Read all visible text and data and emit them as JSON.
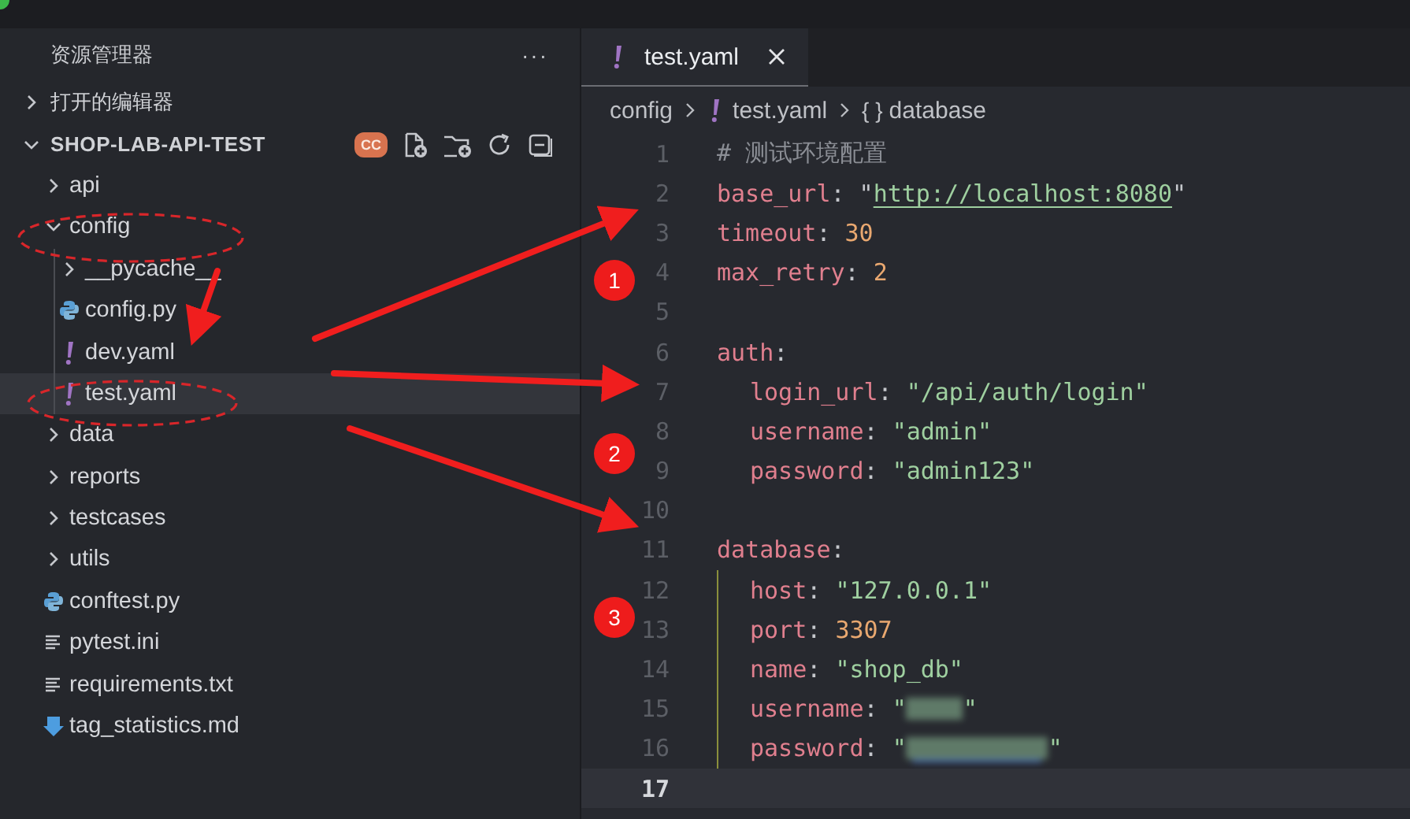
{
  "sidebar": {
    "title": "资源管理器",
    "more": "···",
    "sections": [
      {
        "label": "打开的编辑器",
        "expanded": false
      },
      {
        "label": "SHOP-LAB-API-TEST",
        "expanded": true,
        "badge": "CC"
      }
    ],
    "tree": [
      {
        "name": "api",
        "kind": "folder",
        "expanded": false,
        "selected": false
      },
      {
        "name": "config",
        "kind": "folder",
        "expanded": true,
        "selected": false,
        "children": [
          {
            "name": "__pycache__",
            "kind": "folder",
            "expanded": false,
            "selected": false
          },
          {
            "name": "config.py",
            "kind": "python",
            "selected": false
          },
          {
            "name": "dev.yaml",
            "kind": "yaml",
            "selected": false
          },
          {
            "name": "test.yaml",
            "kind": "yaml",
            "selected": true
          }
        ]
      },
      {
        "name": "data",
        "kind": "folder",
        "expanded": false,
        "selected": false
      },
      {
        "name": "reports",
        "kind": "folder",
        "expanded": false,
        "selected": false
      },
      {
        "name": "testcases",
        "kind": "folder",
        "expanded": false,
        "selected": false
      },
      {
        "name": "utils",
        "kind": "folder",
        "expanded": false,
        "selected": false
      },
      {
        "name": "conftest.py",
        "kind": "python",
        "selected": false
      },
      {
        "name": "pytest.ini",
        "kind": "text",
        "selected": false
      },
      {
        "name": "requirements.txt",
        "kind": "text",
        "selected": false
      },
      {
        "name": "tag_statistics.md",
        "kind": "markdown",
        "selected": false
      }
    ]
  },
  "tabs": [
    {
      "label": "test.yaml",
      "kind": "yaml",
      "selected": true
    }
  ],
  "breadcrumb": [
    {
      "kind": "folder",
      "label": "config"
    },
    {
      "kind": "yaml",
      "label": "test.yaml"
    },
    {
      "kind": "symbol",
      "glyph": "{ }",
      "label": "database"
    }
  ],
  "lines": [
    {
      "number": "1",
      "current": false,
      "kind": "top",
      "tokens": [
        {
          "kind": "comment",
          "text": "# 测试环境配置"
        }
      ]
    },
    {
      "number": "2",
      "current": false,
      "kind": "top",
      "tokens": [
        {
          "kind": "key",
          "text": "base_url"
        },
        {
          "kind": "punct",
          "text": ": \""
        },
        {
          "kind": "link",
          "text": "http://localhost:8080"
        },
        {
          "kind": "punct",
          "text": "\""
        }
      ]
    },
    {
      "number": "3",
      "current": false,
      "kind": "top",
      "tokens": [
        {
          "kind": "key",
          "text": "timeout"
        },
        {
          "kind": "punct",
          "text": ": "
        },
        {
          "kind": "num",
          "text": "30"
        }
      ]
    },
    {
      "number": "4",
      "current": false,
      "kind": "top",
      "tokens": [
        {
          "kind": "key",
          "text": "max_retry"
        },
        {
          "kind": "punct",
          "text": ": "
        },
        {
          "kind": "num",
          "text": "2"
        }
      ]
    },
    {
      "number": "5",
      "current": false,
      "kind": "top"
    },
    {
      "number": "6",
      "current": false,
      "kind": "top",
      "tokens": [
        {
          "kind": "key",
          "text": "auth"
        },
        {
          "kind": "punct",
          "text": ":"
        }
      ]
    },
    {
      "number": "7",
      "current": false,
      "kind": "nested",
      "tokens": [
        {
          "kind": "key",
          "text": "login_url"
        },
        {
          "kind": "punct",
          "text": ": "
        },
        {
          "kind": "str",
          "text": "\"/api/auth/login\""
        }
      ]
    },
    {
      "number": "8",
      "current": false,
      "kind": "nested",
      "tokens": [
        {
          "kind": "key",
          "text": "username"
        },
        {
          "kind": "punct",
          "text": ": "
        },
        {
          "kind": "str",
          "text": "\"admin\""
        }
      ]
    },
    {
      "number": "9",
      "current": false,
      "kind": "nested",
      "tokens": [
        {
          "kind": "key",
          "text": "password"
        },
        {
          "kind": "punct",
          "text": ": "
        },
        {
          "kind": "str",
          "text": "\"admin123\""
        }
      ]
    },
    {
      "number": "10",
      "current": false,
      "kind": "top"
    },
    {
      "number": "11",
      "current": false,
      "kind": "top",
      "tokens": [
        {
          "kind": "key",
          "text": "database"
        },
        {
          "kind": "punct",
          "text": ":"
        }
      ]
    },
    {
      "number": "12",
      "current": false,
      "kind": "guided",
      "tokens": [
        {
          "kind": "key",
          "text": "host"
        },
        {
          "kind": "punct",
          "text": ": "
        },
        {
          "kind": "str",
          "text": "\"127.0.0.1\""
        }
      ]
    },
    {
      "number": "13",
      "current": false,
      "kind": "guided",
      "tokens": [
        {
          "kind": "key",
          "text": "port"
        },
        {
          "kind": "punct",
          "text": ": "
        },
        {
          "kind": "num",
          "text": "3307"
        }
      ]
    },
    {
      "number": "14",
      "current": false,
      "kind": "guided",
      "tokens": [
        {
          "kind": "key",
          "text": "name"
        },
        {
          "kind": "punct",
          "text": ": "
        },
        {
          "kind": "str",
          "text": "\"shop_db\""
        }
      ]
    },
    {
      "number": "15",
      "current": false,
      "kind": "guided",
      "tokens": [
        {
          "kind": "key",
          "text": "username"
        },
        {
          "kind": "punct",
          "text": ": "
        },
        {
          "kind": "str",
          "text": "\""
        },
        {
          "kind": "redacted-short",
          "squiggle": false
        },
        {
          "kind": "str",
          "text": "\""
        }
      ]
    },
    {
      "number": "16",
      "current": false,
      "kind": "guided",
      "tokens": [
        {
          "kind": "key",
          "text": "password"
        },
        {
          "kind": "punct",
          "text": ": "
        },
        {
          "kind": "str",
          "text": "\""
        },
        {
          "kind": "redacted-long",
          "squiggle": true
        },
        {
          "kind": "str",
          "text": "\""
        }
      ]
    },
    {
      "number": "17",
      "current": true,
      "kind": "top"
    }
  ],
  "annotations": {
    "badges": [
      "1",
      "2",
      "3"
    ]
  }
}
